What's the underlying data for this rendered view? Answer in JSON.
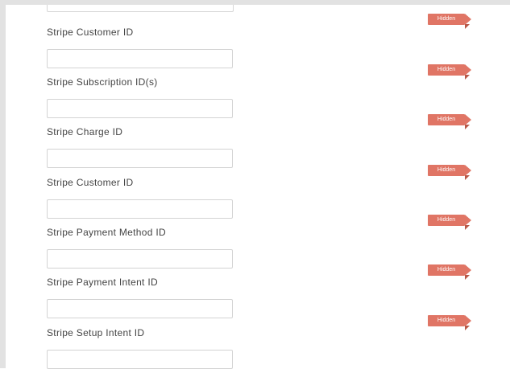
{
  "tag_color": "#e07565",
  "fields": [
    {
      "label": "Stripe Customer ID",
      "value": "",
      "badge": "Hidden"
    },
    {
      "label": "Stripe Subscription ID(s)",
      "value": "",
      "badge": "Hidden"
    },
    {
      "label": "Stripe Charge ID",
      "value": "",
      "badge": "Hidden"
    },
    {
      "label": "Stripe Customer ID",
      "value": "",
      "badge": "Hidden"
    },
    {
      "label": "Stripe Payment Method ID",
      "value": "",
      "badge": "Hidden"
    },
    {
      "label": "Stripe Payment Intent ID",
      "value": "",
      "badge": "Hidden"
    },
    {
      "label": "Stripe Setup Intent ID",
      "value": "",
      "badge": "Hidden"
    }
  ]
}
